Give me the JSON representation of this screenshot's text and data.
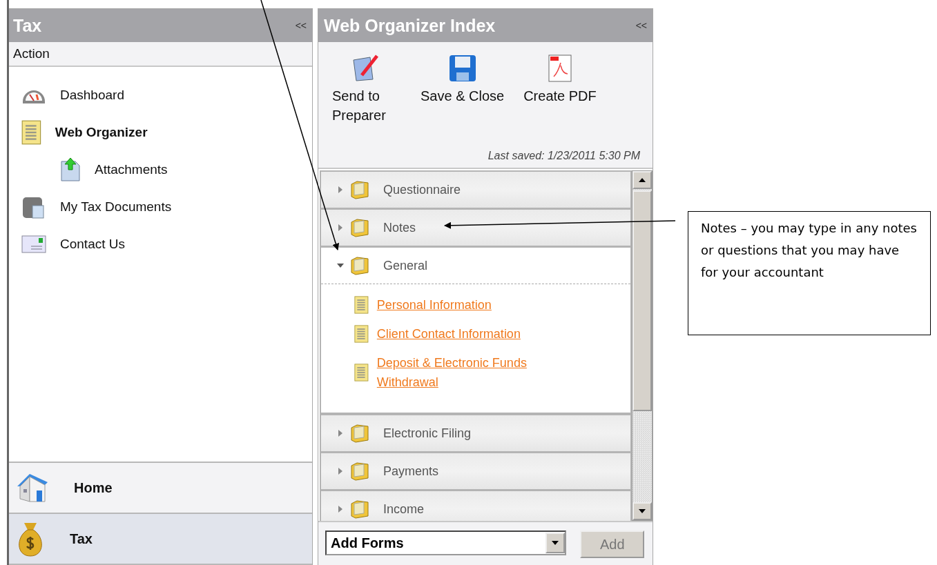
{
  "tax_panel": {
    "title": "Tax",
    "collapse": "<<",
    "section": "Action",
    "items": [
      {
        "label": "Dashboard",
        "selected": false
      },
      {
        "label": "Web Organizer",
        "selected": true,
        "children": [
          {
            "label": "Attachments",
            "selected": false
          }
        ]
      },
      {
        "label": "My Tax Documents",
        "selected": false
      },
      {
        "label": "Contact Us",
        "selected": false
      }
    ],
    "modules": [
      {
        "label": "Home",
        "selected": false
      },
      {
        "label": "Tax",
        "selected": true
      }
    ]
  },
  "index_panel": {
    "title": "Web Organizer Index",
    "collapse": "<<",
    "toolbar": [
      {
        "label": "Send to Preparer"
      },
      {
        "label": "Save & Close"
      },
      {
        "label": "Create PDF"
      }
    ],
    "last_saved": "Last saved: 1/23/2011 5:30 PM",
    "sections": [
      {
        "label": "Questionnaire",
        "expanded": false
      },
      {
        "label": "Notes",
        "expanded": false
      },
      {
        "label": "General",
        "expanded": true,
        "forms": [
          "Personal Information",
          "Client Contact Information",
          "Deposit & Electronic Funds Withdrawal"
        ]
      },
      {
        "label": "Electronic Filing",
        "expanded": false
      },
      {
        "label": "Payments",
        "expanded": false
      },
      {
        "label": "Income",
        "expanded": false
      }
    ],
    "add_forms": {
      "value": "Add Forms",
      "button": "Add"
    }
  },
  "callout": {
    "text": "Notes – you may type in any notes or questions that you may have for your accountant"
  }
}
